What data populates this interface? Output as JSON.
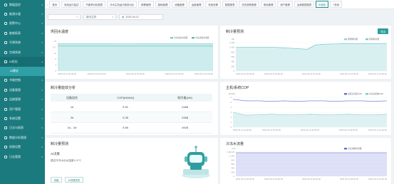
{
  "sidebar": {
    "items": [
      {
        "label": "数据监控",
        "open": false
      },
      {
        "label": "能源计量",
        "open": false
      },
      {
        "label": "报警中心",
        "open": false
      },
      {
        "label": "能耗报表",
        "open": false
      },
      {
        "label": "冷源系统",
        "open": false
      },
      {
        "label": "空调系统",
        "open": false
      },
      {
        "label": "AI优化",
        "open": true
      },
      {
        "label": "节能控制",
        "open": false
      },
      {
        "label": "设备管理",
        "open": false
      },
      {
        "label": "运维管理",
        "open": false
      },
      {
        "label": "用户管理",
        "open": false
      },
      {
        "label": "系统设置",
        "open": false
      },
      {
        "label": "日志与报表",
        "open": false
      },
      {
        "label": "数据分析管理",
        "open": false
      },
      {
        "label": "权限设置",
        "open": false
      },
      {
        "label": "日志管理",
        "open": false
      }
    ],
    "sub_items": [
      {
        "label": "AI建议",
        "active": true
      }
    ]
  },
  "tabs": [
    "首页",
    "系统运行监控",
    "节能率分析报表",
    "冷水主机运行能效对比",
    "报警管理",
    "能耗管理",
    "设备管理",
    "运维管理",
    "系统设置",
    "数据报表",
    "历史趋势管理",
    "角色管理",
    "用户管理",
    "运维数据报表",
    "AI优化",
    "+关闭"
  ],
  "filters": {
    "project": "",
    "chiller": "制冷主机",
    "date": "2025-06-12"
  },
  "panels": {
    "chilled_temp": {
      "title": "供回水温度"
    },
    "cooling_load": {
      "title": "制冷量预测",
      "button": "导出"
    },
    "efficiency": {
      "title": "制冷量能效分析"
    },
    "cop": {
      "title": "主机/系统COP"
    },
    "forecast": {
      "title": "制冷量预测",
      "ai_title": "AI决策",
      "ai_text": "建议冷冻水出水温度11.0°C",
      "buttons": [
        "详细",
        "AI决策历史"
      ]
    },
    "chilled_flow": {
      "title": "冷冻水流量"
    }
  },
  "table": {
    "headers": [
      "设备组合",
      "COP(kW/kW)",
      "制冷量(kW)"
    ],
    "rows": [
      [
        "1#",
        "5.91",
        "2468"
      ],
      [
        "2#",
        "5.39",
        "2468"
      ],
      [
        "1#、2#",
        "5.65",
        "4928"
      ]
    ]
  },
  "colors": {
    "sidebar": "#1b7a7e",
    "accent": "#2f9d9f",
    "series_a": "#8fd3d6",
    "series_b": "#5b6fd8"
  },
  "chart_data": [
    {
      "type": "area",
      "title": "供回水温度",
      "x": [
        "2025-06-12 00:00:00",
        "2025-06-12 02:00:00",
        "2025-06-12 04:00:00",
        "2025-06-12 07:00:00",
        "2025-06-12 10:00:00"
      ],
      "ylim": [
        0,
        16
      ],
      "yticks": [
        "16",
        "14.7",
        "12",
        "8",
        "4",
        "0"
      ],
      "legend": "top-right",
      "series": [
        {
          "name": "冷冻水出水温度",
          "values": [
            14.7,
            14.7,
            14.7,
            14.7,
            14.6,
            14.7,
            14.7,
            14.7,
            14.7,
            14.7
          ]
        },
        {
          "name": "冷冻水回水温度",
          "values": [
            13.4,
            13.4,
            13.4,
            13.4,
            13.4,
            13.4,
            13.4,
            13.4,
            13.4,
            13.4
          ]
        }
      ]
    },
    {
      "type": "area",
      "title": "制冷量预测",
      "x": [
        "2025-06-12 00:00:00",
        "2025-06-12 06:00:00",
        "2025-06-12 12:00:00",
        "2025-06-12 18:00:00",
        "2025-06-12 23:00:00"
      ],
      "ylabel": "kW",
      "yticks": [
        "1,200",
        "1,000",
        "800",
        "600",
        "400",
        "200",
        "0"
      ],
      "ylim": [
        0,
        1200
      ],
      "legend": "top-right",
      "series": [
        {
          "name": "预测制冷量",
          "values": [
            1000,
            1000,
            1000,
            1000,
            1000,
            1000,
            980,
            960,
            940,
            920,
            1100,
            1130,
            1140,
            1150,
            1160,
            1160,
            1160,
            1160,
            1160,
            1160
          ]
        },
        {
          "name": "实际制冷量",
          "values": [
            1000,
            1000,
            1000,
            1000,
            1000,
            1000,
            980,
            960,
            940,
            920,
            1100,
            1130,
            1140,
            1150,
            1160,
            1160,
            1160,
            1160,
            1160,
            1160
          ]
        }
      ]
    },
    {
      "type": "line",
      "title": "主机/系统COP",
      "x": [
        "2025-06-12 00:00:00",
        "2025-06-12 03:00:00",
        "2025-06-12 06:00:00",
        "2025-06-12 09:00:00",
        "2025-06-12 10:00:00"
      ],
      "ylabel": "kW/kW",
      "yticks": [
        "6",
        "5",
        "4",
        "3",
        "2",
        "1",
        "0"
      ],
      "ylim": [
        0,
        6
      ],
      "legend": "top-right",
      "series": [
        {
          "name": "主机冷冻机COP",
          "values": [
            5.6,
            5.3,
            5.3,
            5.2,
            5.3,
            5.2,
            5.3,
            5.3,
            5.2,
            5.3,
            5.3,
            5.2,
            5.3
          ]
        },
        {
          "name": "冷冻水系统COP",
          "values": [
            3.0,
            2.4,
            2.5,
            2.6,
            2.5,
            2.5,
            2.6,
            2.5,
            2.5,
            2.6,
            2.5,
            2.5,
            2.6
          ]
        }
      ]
    },
    {
      "type": "area",
      "title": "冷冻水流量",
      "x": [
        "2025-06-12 00:00:00",
        "2025-06-12 04:00:00",
        "2025-06-12 06:00:00",
        "2025-06-12 08:00:00",
        "2025-06-12 10:00:00"
      ],
      "ylabel": "m³/h",
      "yticks": [
        "1,166.48",
        "1,000",
        "800",
        "600",
        "400",
        "200",
        "0"
      ],
      "ylim": [
        0,
        1200
      ],
      "legend": "top-right",
      "series": [
        {
          "name": "冷冻水瞬时流量",
          "values": [
            1166,
            1166,
            1166,
            1166,
            1166,
            1166,
            1166,
            1166,
            1166,
            1166
          ]
        }
      ]
    }
  ]
}
